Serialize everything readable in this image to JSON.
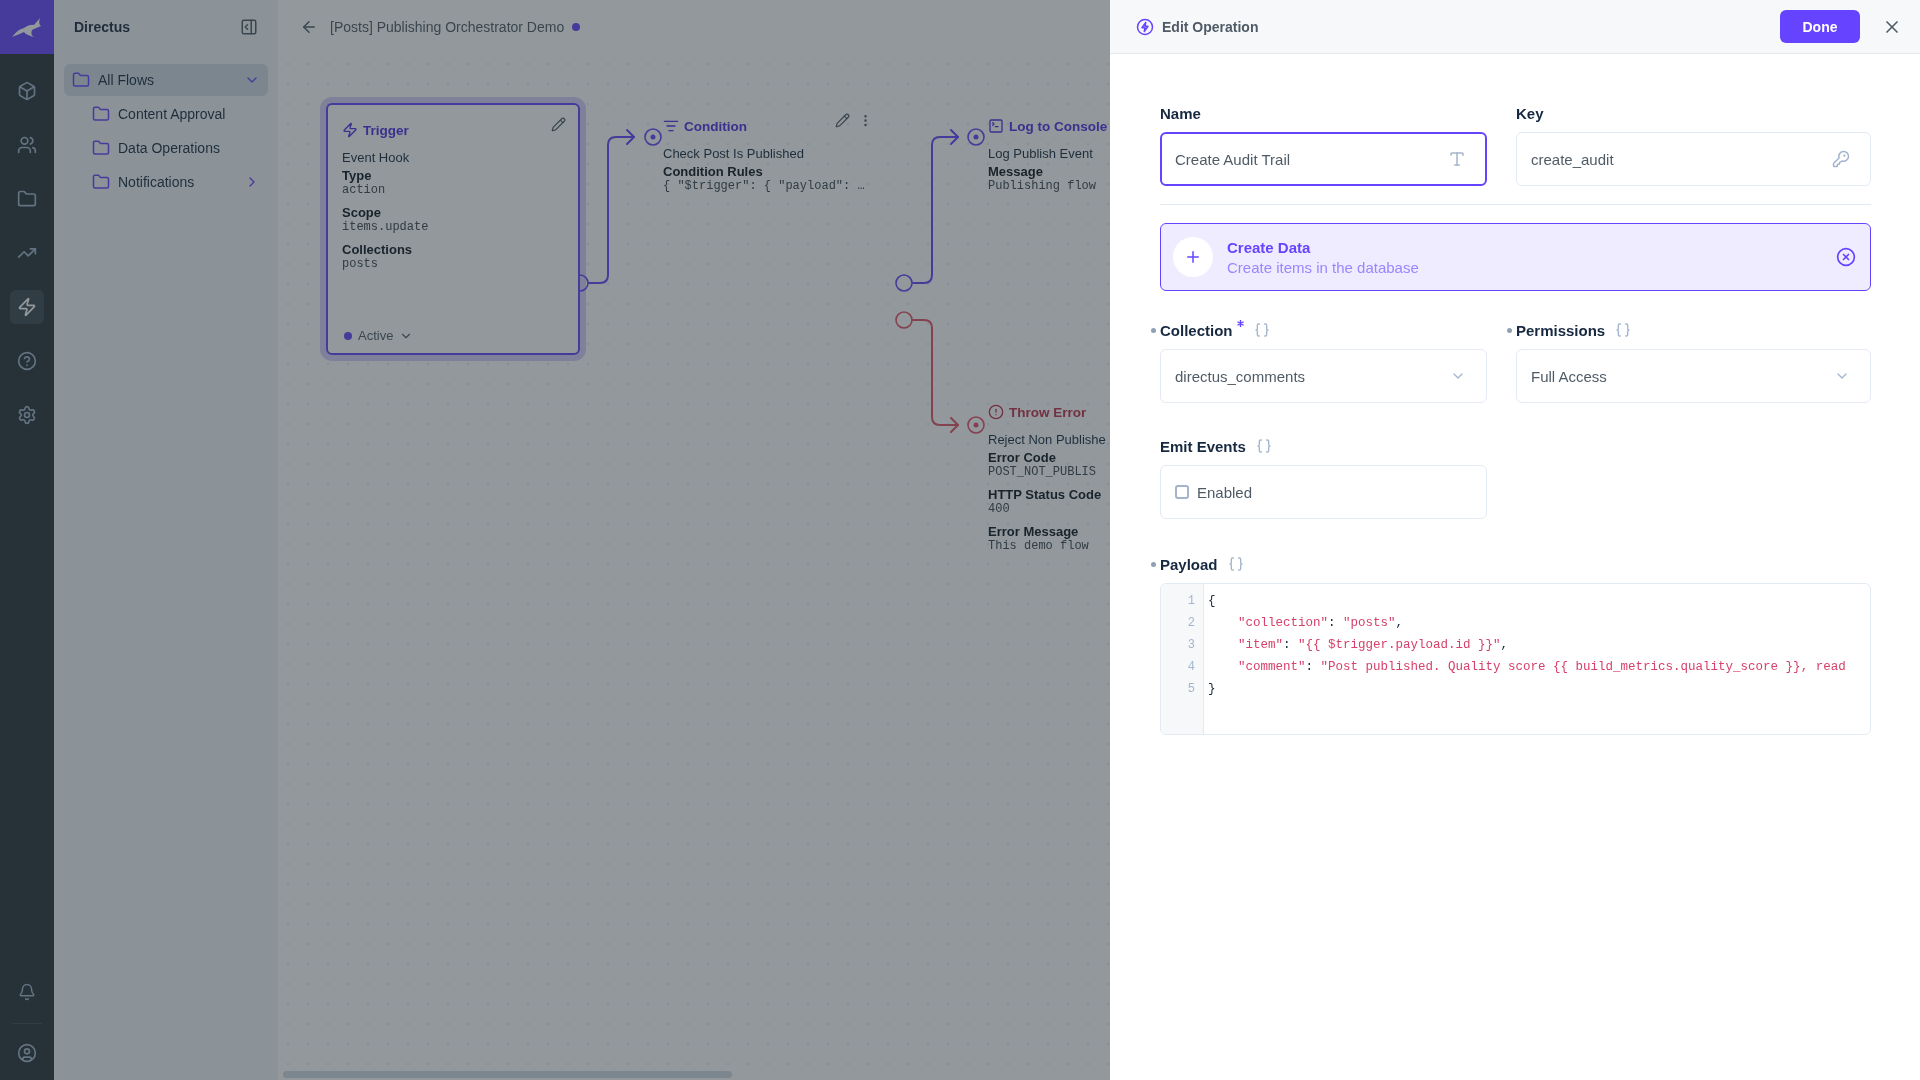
{
  "module_bar": {
    "items": [
      {
        "selected": false
      },
      {
        "selected": false
      },
      {
        "selected": false
      },
      {
        "selected": false
      },
      {
        "selected": true
      },
      {
        "selected": false
      },
      {
        "selected": false
      }
    ]
  },
  "nav": {
    "title": "Directus",
    "items": [
      {
        "label": "All Flows",
        "selected": true,
        "expanded": true,
        "children": [
          {
            "label": "Content Approval",
            "kind": "leaf"
          },
          {
            "label": "Data Operations",
            "kind": "leaf"
          },
          {
            "label": "Notifications",
            "kind": "group",
            "expanded": false
          }
        ]
      }
    ]
  },
  "header": {
    "title": "[Posts] Publishing Orchestrator Demo",
    "unsaved": true
  },
  "flow": {
    "nodes": [
      {
        "kind": "trigger",
        "title": "Trigger",
        "selected": true,
        "name": "Event Hook",
        "fields": [
          {
            "label": "Type",
            "value": "action"
          },
          {
            "label": "Scope",
            "value": "items.update"
          },
          {
            "label": "Collections",
            "value": "posts"
          }
        ],
        "status": "Active",
        "active": true
      },
      {
        "kind": "condition",
        "title": "Condition",
        "selected": false,
        "name": "Check Post Is Published",
        "fields": [
          {
            "label": "Condition Rules",
            "value": "{ \"$trigger\": { \"payload\": …"
          }
        ]
      },
      {
        "kind": "log",
        "title": "Log to Console",
        "selected": false,
        "name": "Log Publish Event",
        "fields": [
          {
            "label": "Message",
            "value": "Publishing flow"
          }
        ]
      },
      {
        "kind": "error",
        "title": "Throw Error",
        "selected": false,
        "name": "Reject Non Publishe",
        "fields": [
          {
            "label": "Error Code",
            "value": "POST_NOT_PUBLIS"
          },
          {
            "label": "HTTP Status Code",
            "value": "400"
          },
          {
            "label": "Error Message",
            "value": "This demo flow"
          }
        ]
      }
    ]
  },
  "drawer": {
    "title": "Edit Operation",
    "done": "Done",
    "name": {
      "label": "Name",
      "value": "Create Audit Trail",
      "focused": true
    },
    "key": {
      "label": "Key",
      "value": "create_audit",
      "focused": false
    },
    "operation": {
      "title": "Create Data",
      "description": "Create items in the database"
    },
    "collection": {
      "label": "Collection",
      "value": "directus_comments",
      "required": true,
      "marked": true
    },
    "permissions": {
      "label": "Permissions",
      "value": "Full Access",
      "required": false,
      "marked": true
    },
    "emit_events": {
      "label": "Emit Events",
      "marked": false,
      "option": "Enabled",
      "checked": false
    },
    "payload": {
      "label": "Payload",
      "marked": true,
      "lines": [
        {
          "number": "1",
          "code": "{"
        },
        {
          "number": "2",
          "code": "    \"collection\": \"posts\","
        },
        {
          "number": "3",
          "code": "    \"item\": \"{{ $trigger.payload.id }}\","
        },
        {
          "number": "4",
          "code": "    \"comment\": \"Post published. Quality score {{ build_metrics.quality_score }}, read"
        },
        {
          "number": "5",
          "code": "}"
        }
      ]
    }
  }
}
